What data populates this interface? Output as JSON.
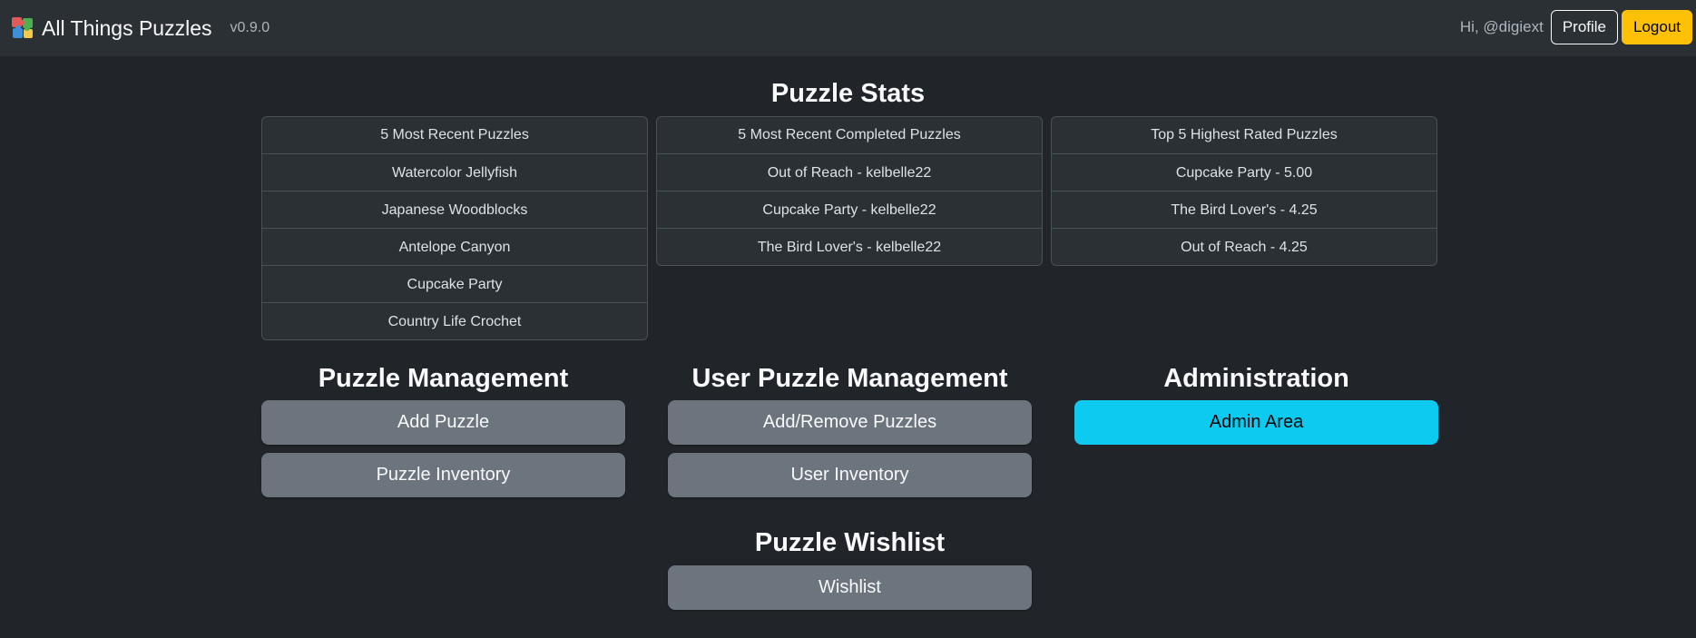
{
  "navbar": {
    "brand_name": "All Things Puzzles",
    "version": "v0.9.0",
    "greeting": "Hi, @digiext",
    "profile_label": "Profile",
    "logout_label": "Logout"
  },
  "stats": {
    "title": "Puzzle Stats",
    "recent_puzzles": {
      "header": "5 Most Recent Puzzles",
      "items": [
        "Watercolor Jellyfish",
        "Japanese Woodblocks",
        "Antelope Canyon",
        "Cupcake Party",
        "Country Life Crochet"
      ]
    },
    "recent_completed": {
      "header": "5 Most Recent Completed Puzzles",
      "items": [
        "Out of Reach - kelbelle22",
        "Cupcake Party - kelbelle22",
        "The Bird Lover's - kelbelle22"
      ]
    },
    "top_rated": {
      "header": "Top 5 Highest Rated Puzzles",
      "items": [
        "Cupcake Party - 5.00",
        "The Bird Lover's - 4.25",
        "Out of Reach - 4.25"
      ]
    }
  },
  "puzzle_management": {
    "title": "Puzzle Management",
    "add_label": "Add Puzzle",
    "inventory_label": "Puzzle Inventory"
  },
  "user_puzzle_management": {
    "title": "User Puzzle Management",
    "add_remove_label": "Add/Remove Puzzles",
    "inventory_label": "User Inventory"
  },
  "administration": {
    "title": "Administration",
    "admin_label": "Admin Area"
  },
  "wishlist": {
    "title": "Puzzle Wishlist",
    "wishlist_label": "Wishlist"
  },
  "colors": {
    "background": "#212529",
    "navbar": "#2b3035",
    "secondary_button": "#6c757d",
    "info_button": "#0dcaf0",
    "warning_button": "#ffc107"
  }
}
